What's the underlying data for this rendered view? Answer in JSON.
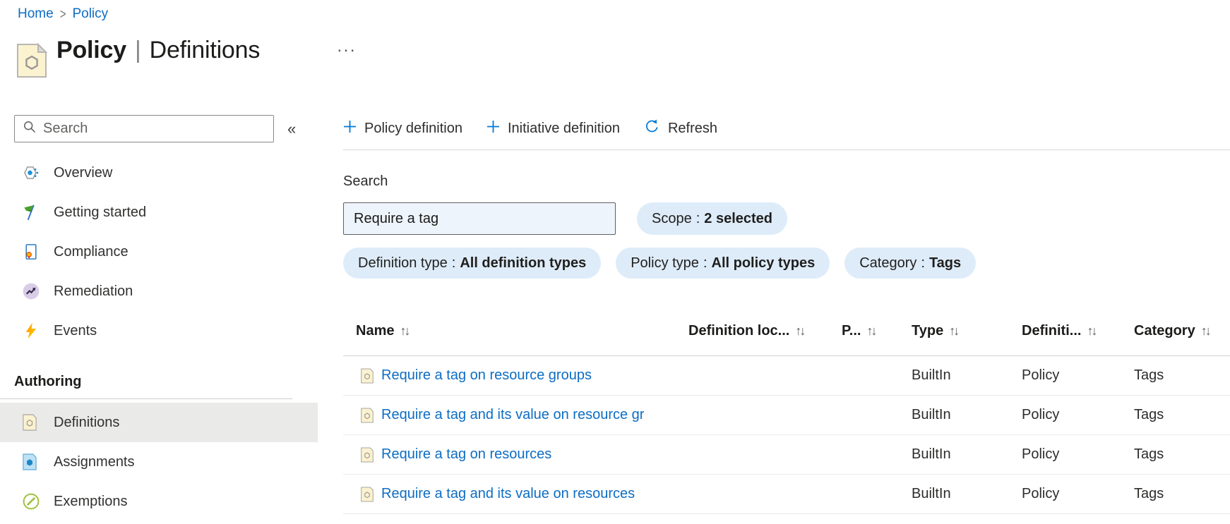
{
  "breadcrumb": {
    "separator": ">",
    "items": [
      {
        "label": "Home"
      },
      {
        "label": "Policy"
      }
    ]
  },
  "header": {
    "title_primary": "Policy",
    "title_separator": "|",
    "title_secondary": "Definitions",
    "more_label": "···"
  },
  "sidebar": {
    "search_placeholder": "Search",
    "collapse_glyph": "«",
    "items": [
      {
        "label": "Overview",
        "icon": "overview-icon"
      },
      {
        "label": "Getting started",
        "icon": "getting-started-flag-icon"
      },
      {
        "label": "Compliance",
        "icon": "compliance-icon"
      },
      {
        "label": "Remediation",
        "icon": "remediation-icon"
      },
      {
        "label": "Events",
        "icon": "events-lightning-icon"
      }
    ],
    "section": {
      "label": "Authoring",
      "items": [
        {
          "label": "Definitions",
          "icon": "definitions-policy-icon",
          "selected": true
        },
        {
          "label": "Assignments",
          "icon": "assignments-icon",
          "selected": false
        },
        {
          "label": "Exemptions",
          "icon": "exemptions-icon",
          "selected": false
        }
      ]
    }
  },
  "toolbar": {
    "buttons": [
      {
        "label": "Policy definition",
        "icon": "plus-icon"
      },
      {
        "label": "Initiative definition",
        "icon": "plus-icon"
      },
      {
        "label": "Refresh",
        "icon": "refresh-icon"
      }
    ]
  },
  "filters": {
    "search_label": "Search",
    "search_value": "Require a tag",
    "pill_separator": ":",
    "pills": [
      {
        "label": "Scope",
        "value": "2 selected"
      },
      {
        "label": "Definition type",
        "value": "All definition types"
      },
      {
        "label": "Policy type",
        "value": "All policy types"
      },
      {
        "label": "Category",
        "value": "Tags"
      }
    ]
  },
  "table": {
    "sort_glyph": "↑↓",
    "columns": [
      "Name",
      "Definition loc...",
      "P...",
      "Type",
      "Definiti...",
      "Category"
    ],
    "rows": [
      {
        "name": "Require a tag on resource groups",
        "definition_location": "",
        "policies": "",
        "type": "BuiltIn",
        "definition_type": "Policy",
        "category": "Tags"
      },
      {
        "name": "Require a tag and its value on resource gr",
        "definition_location": "",
        "policies": "",
        "type": "BuiltIn",
        "definition_type": "Policy",
        "category": "Tags"
      },
      {
        "name": "Require a tag on resources",
        "definition_location": "",
        "policies": "",
        "type": "BuiltIn",
        "definition_type": "Policy",
        "category": "Tags"
      },
      {
        "name": "Require a tag and its value on resources",
        "definition_location": "",
        "policies": "",
        "type": "BuiltIn",
        "definition_type": "Policy",
        "category": "Tags"
      }
    ]
  },
  "colors": {
    "accent": "#0078d4",
    "link": "#0d6dc4",
    "pill_bg": "#deecf9",
    "input_bg": "#eef4fc",
    "selected_bg": "#eaeae8"
  }
}
